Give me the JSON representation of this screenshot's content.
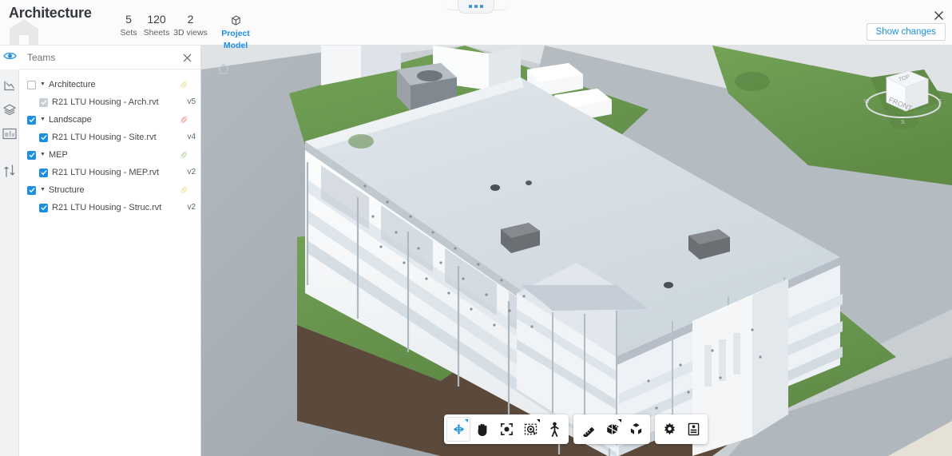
{
  "header": {
    "project_title": "Architecture",
    "logo_icon": "house-logo-icon",
    "stats": [
      {
        "value": "5",
        "label": "Sets"
      },
      {
        "value": "120",
        "label": "Sheets"
      },
      {
        "value": "2",
        "label": "3D views"
      }
    ],
    "model_tab": {
      "label": "Project Model",
      "icon": "cube-icon",
      "accent": "#1a8fe3"
    },
    "show_changes_label": "Show changes",
    "close_icon": "close-icon",
    "drag_handle_icon": "three-dots-handle-icon"
  },
  "icon_rail": {
    "items": [
      {
        "name": "visibility-icon",
        "active": true
      },
      {
        "name": "markup-pen-icon",
        "active": false
      },
      {
        "name": "layers-icon",
        "active": false
      },
      {
        "name": "sheet-compare-icon",
        "active": false
      },
      {
        "name": "versions-icon",
        "active": false
      }
    ]
  },
  "panel": {
    "title": "Teams",
    "close_icon": "close-icon",
    "groups": [
      {
        "name": "Architecture",
        "checked": false,
        "expanded": true,
        "badge_color": "#f2e9b4",
        "children": [
          {
            "name": "R21 LTU Housing - Arch.rvt",
            "version": "v5",
            "checked": true,
            "dimmed": true
          }
        ]
      },
      {
        "name": "Landscape",
        "checked": true,
        "expanded": true,
        "badge_color": "#f3b2b2",
        "children": [
          {
            "name": "R21 LTU Housing - Site.rvt",
            "version": "v4",
            "checked": true,
            "dimmed": false
          }
        ]
      },
      {
        "name": "MEP",
        "checked": true,
        "expanded": true,
        "badge_color": "#c8e3bd",
        "children": [
          {
            "name": "R21 LTU Housing - MEP.rvt",
            "version": "v2",
            "checked": true,
            "dimmed": false
          }
        ]
      },
      {
        "name": "Structure",
        "checked": true,
        "expanded": true,
        "badge_color": "#f2e9b4",
        "children": [
          {
            "name": "R21 LTU Housing - Struc.rvt",
            "version": "v2",
            "checked": true,
            "dimmed": false
          }
        ]
      }
    ]
  },
  "viewport": {
    "home_icon": "home-icon",
    "viewcube": {
      "top_face_label": "TOP",
      "front_face_label": "FRONT",
      "compass": {
        "west": "W",
        "south": "S",
        "east": "E"
      }
    },
    "colors": {
      "sky": "#eceef0",
      "road": "#a9b0b6",
      "grass": "#6e9a52",
      "soil": "#5b4a3c",
      "building": "#f2f4f6",
      "building_shade": "#cfd6dc",
      "sand": "#e8e3d8"
    }
  },
  "toolbar": {
    "groups": [
      {
        "buttons": [
          {
            "name": "orbit-tool-button",
            "icon": "orbit-icon",
            "active": true,
            "has_corner": true
          },
          {
            "name": "pan-tool-button",
            "icon": "hand-icon",
            "active": false,
            "has_corner": false
          },
          {
            "name": "zoom-fit-tool-button",
            "icon": "fit-view-icon",
            "active": false,
            "has_corner": false
          },
          {
            "name": "zoom-window-tool-button",
            "icon": "zoom-window-icon",
            "active": false,
            "has_corner": true
          },
          {
            "name": "walk-tool-button",
            "icon": "person-walk-icon",
            "active": false,
            "has_corner": false
          }
        ]
      },
      {
        "buttons": [
          {
            "name": "measure-tool-button",
            "icon": "ruler-icon",
            "active": false,
            "has_corner": false
          },
          {
            "name": "section-tool-button",
            "icon": "section-box-icon",
            "active": false,
            "has_corner": true
          },
          {
            "name": "explode-tool-button",
            "icon": "explode-icon",
            "active": false,
            "has_corner": false
          }
        ]
      },
      {
        "buttons": [
          {
            "name": "settings-button",
            "icon": "gear-icon",
            "active": false,
            "has_corner": false
          },
          {
            "name": "properties-button",
            "icon": "properties-icon",
            "active": false,
            "has_corner": false
          }
        ]
      }
    ]
  }
}
